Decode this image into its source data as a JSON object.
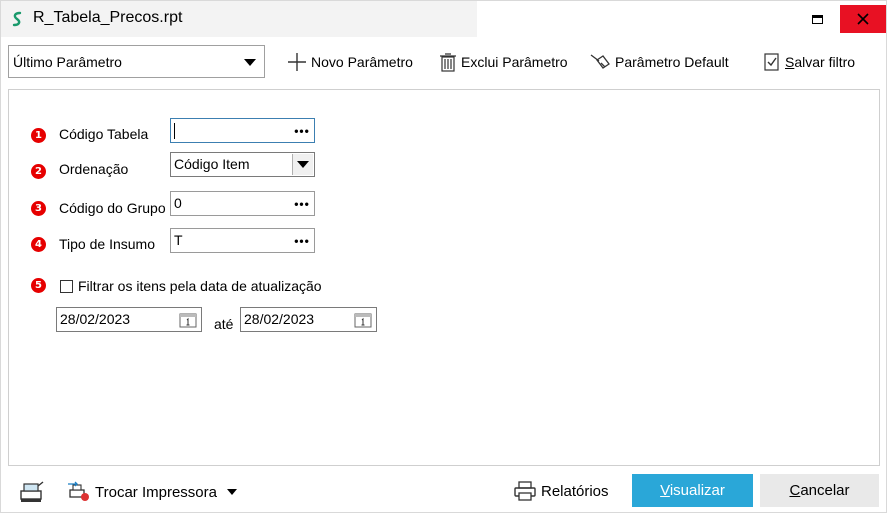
{
  "window": {
    "title": "R_Tabela_Precos.rpt"
  },
  "toolbar": {
    "param_select_value": "Último Parâmetro",
    "novo_parametro": "Novo Parâmetro",
    "exclui_parametro": "Exclui Parâmetro",
    "parametro_default": "Parâmetro Default",
    "salvar_filtro_first": "S",
    "salvar_filtro_rest": "alvar filtro"
  },
  "form": {
    "rows": [
      {
        "num": "1",
        "label": "Código Tabela",
        "value": ""
      },
      {
        "num": "2",
        "label": "Ordenação",
        "value": "Código Item"
      },
      {
        "num": "3",
        "label": "Código do Grupo",
        "value": "0"
      },
      {
        "num": "4",
        "label": "Tipo de Insumo",
        "value": "T"
      },
      {
        "num": "5",
        "label": "Filtrar os itens pela data de atualização",
        "value": ""
      }
    ],
    "date_from": "28/02/2023",
    "date_sep": "até",
    "date_to": "28/02/2023",
    "filter_checked": false
  },
  "bottom": {
    "trocar_impressora": "Trocar Impressora",
    "relatorios": "Relatórios",
    "visualizar_first": "V",
    "visualizar_rest": "isualizar",
    "cancelar_first": "C",
    "cancelar_rest": "ancelar"
  },
  "colors": {
    "accent": "#2aa7d8",
    "close": "#e81123",
    "badge": "#e60000"
  },
  "icons": {
    "app": "report-s-icon",
    "calendar": "calendar-icon",
    "printer": "printer-icon"
  }
}
